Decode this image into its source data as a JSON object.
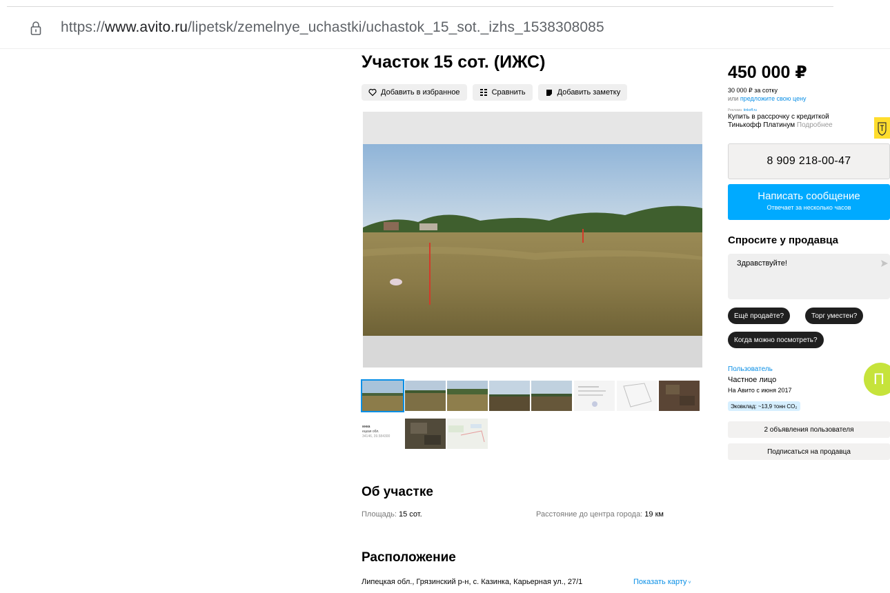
{
  "browser": {
    "url_prefix": "https://",
    "url_host": "www.avito.ru",
    "url_path": "/lipetsk/zemelnye_uchastki/uchastok_15_sot._izhs_1538308085"
  },
  "listing": {
    "title": "Участок 15 сот. (ИЖС)",
    "actions": {
      "favorite": "Добавить в избранное",
      "compare": "Сравнить",
      "note": "Добавить заметку"
    },
    "photo_count": 11,
    "thumb_third_row_text": [
      "инка",
      "ецкая обл.",
      "34146, 39.584300"
    ],
    "about": {
      "heading": "Об участке",
      "area_label": "Площадь: ",
      "area_value": "15 сот.",
      "distance_label": "Расстояние до центра города: ",
      "distance_value": "19 км"
    },
    "location": {
      "heading": "Расположение",
      "address": "Липецкая обл., Грязинский р-н, с. Казинка, Карьерная ул., 27/1",
      "show_map": "Показать карту"
    }
  },
  "sidebar": {
    "price": "450 000 ₽",
    "price_per_sotka": "30 000 ₽ за сотку",
    "offer_prefix": "или ",
    "offer_link": "предложите свою цену",
    "ad_label": "Реклама",
    "ad_source": "tinkoff.ru",
    "ad_text": "Купить в рассрочку с кредиткой Тинькофф Платинум",
    "ad_more": "Подробнее",
    "phone": "8 909 218-00-47",
    "message_button": "Написать сообщение",
    "message_sub": "Отвечает за несколько часов",
    "ask_heading": "Спросите у продавца",
    "ask_placeholder": "Здравствуйте!",
    "chips": [
      "Ещё продаёте?",
      "Торг уместен?",
      "Когда можно посмотреть?"
    ],
    "seller": {
      "name": "Пользователь",
      "type": "Частное лицо",
      "since": "На Авито с июня 2017",
      "eco": "Эковклад: ~13,9 тонн CO₂",
      "avatar_letter": "П"
    },
    "ads_button": "2 объявления пользователя",
    "subscribe_button": "Подписаться на продавца"
  },
  "colors": {
    "accent_blue": "#00aaff",
    "link_blue": "#0a8fe6",
    "avatar_green": "#c6e33b",
    "chip_dark": "#1f1f1f"
  }
}
